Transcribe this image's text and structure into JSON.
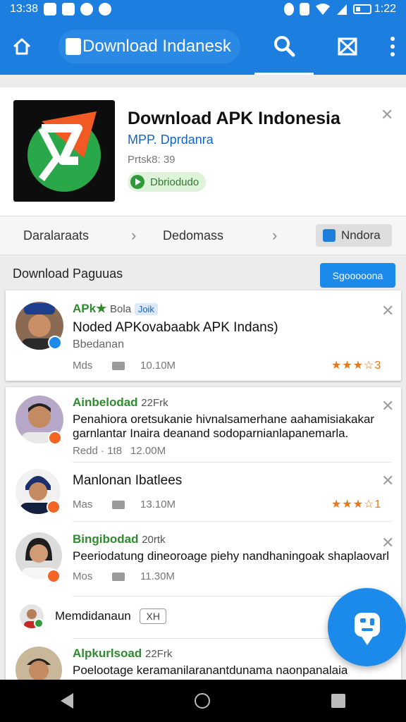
{
  "status": {
    "time_left": "13:38",
    "time_right": "1:22"
  },
  "appbar": {
    "search_value": "Download Indanesk"
  },
  "app": {
    "title": "Download APK Indonesia",
    "developer": "MPP. Dprdanra",
    "size": "Prtsk8: 39",
    "badge": "Dbriodudo"
  },
  "breadcrumb": {
    "items": [
      "Daralaraats",
      "Dedomass",
      "Nndora"
    ]
  },
  "section": {
    "title": "Download Paguuas",
    "button": "Sgooooona"
  },
  "featured": {
    "name": "APk★",
    "name_meta": "Bola",
    "chip": "Joik",
    "desc": "Noded APKovabaabk APK Indans)",
    "sub": "Bbedanan",
    "stat_label": "Mds",
    "stat_value": "10.10M",
    "rating_stars": "★★★☆",
    "rating_value": "3"
  },
  "list_items": [
    {
      "name": "Ainbelodad",
      "name_meta": "22Frk",
      "desc1": "Penahiora oretsukanie hivnalsamerhane aahamisiakakar",
      "desc2": "garnlantar Inaira deanand sodoparnianlapanemarla.",
      "stat_label": "Redd · 1t8",
      "stat_value": "12.00M"
    },
    {
      "name": "Manlonan Ibatlees",
      "stat_label": "Mas",
      "stat_value": "13.10M",
      "rating_stars": "★★★☆",
      "rating_value": "1"
    },
    {
      "name": "Bingibodad",
      "name_meta": "20rtk",
      "desc1": "Peeriodatung dineoroage piehy nandhaningoak shaplaovarl:",
      "stat_label": "Mos",
      "stat_value": "11.30M"
    },
    {
      "name": "Memdidanaun",
      "chip": "XH"
    },
    {
      "name": "Alpkurlsoad",
      "name_meta": "22Frk",
      "desc1": "Poelootage keramanilaranantdunama naonpanalaian"
    }
  ],
  "colors": {
    "primary": "#1c7fe0",
    "accent_green": "#2e8b2e",
    "star": "#e6781a"
  }
}
